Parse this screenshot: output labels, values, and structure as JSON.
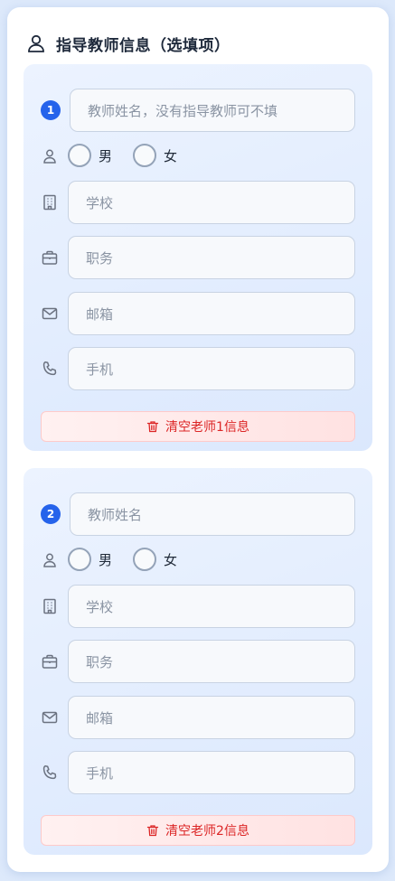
{
  "section": {
    "title": "指导教师信息（选填项）",
    "header_icon": "user-outline-icon"
  },
  "colors": {
    "accent": "#2563eb",
    "danger": "#dc2626",
    "card_bg": "#e4eefd"
  },
  "teachers": [
    {
      "number": "1",
      "name_placeholder": "教师姓名，没有指导教师可不填",
      "gender_options": [
        "男",
        "女"
      ],
      "school_placeholder": "学校",
      "position_placeholder": "职务",
      "email_placeholder": "邮箱",
      "phone_placeholder": "手机",
      "clear_label": "清空老师1信息"
    },
    {
      "number": "2",
      "name_placeholder": "教师姓名",
      "gender_options": [
        "男",
        "女"
      ],
      "school_placeholder": "学校",
      "position_placeholder": "职务",
      "email_placeholder": "邮箱",
      "phone_placeholder": "手机",
      "clear_label": "清空老师2信息"
    }
  ]
}
